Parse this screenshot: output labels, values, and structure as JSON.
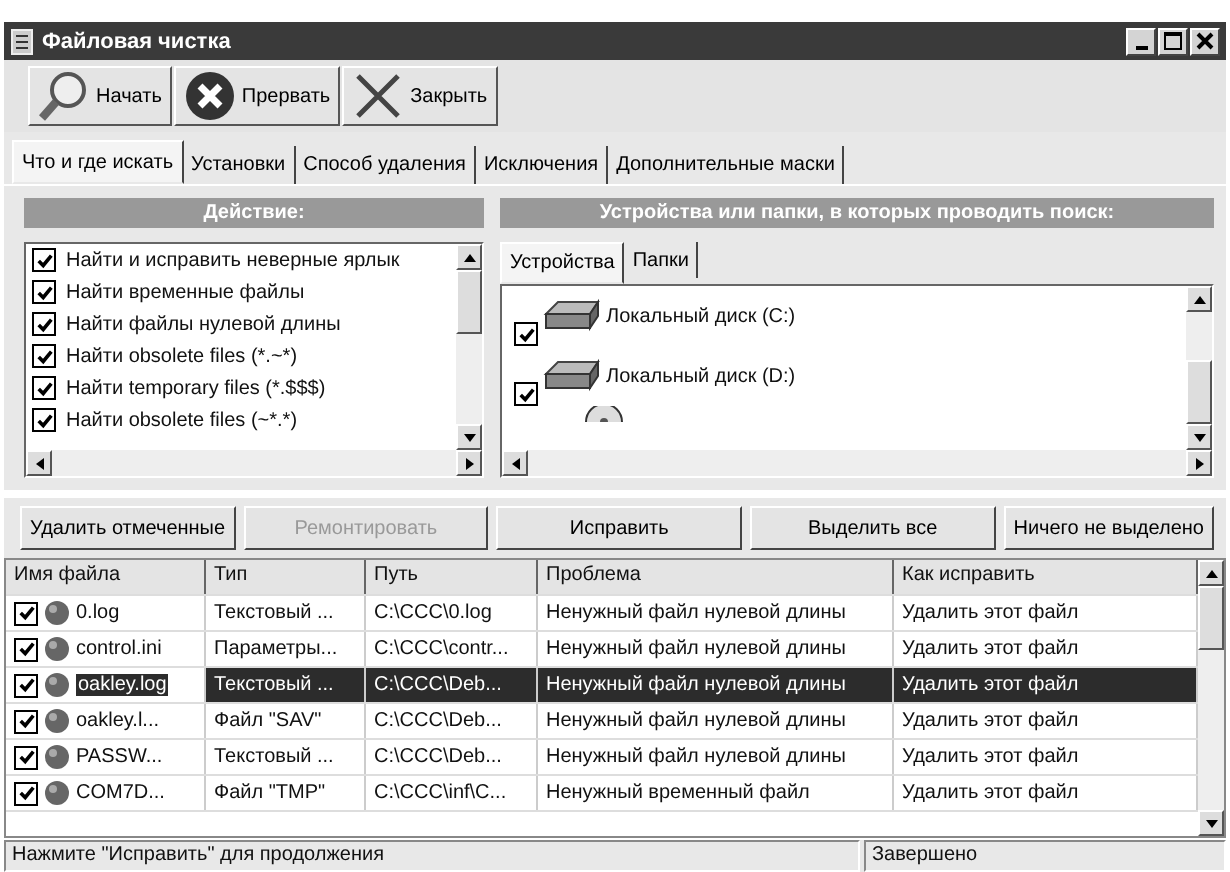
{
  "window": {
    "title": "Файловая чистка"
  },
  "toolbar": [
    {
      "label": "Начать",
      "kind": "search"
    },
    {
      "label": "Прервать",
      "kind": "stop"
    },
    {
      "label": "Закрыть",
      "kind": "close"
    }
  ],
  "tabs": [
    {
      "label": "Что и где искать",
      "selected": true
    },
    {
      "label": "Установки",
      "selected": false
    },
    {
      "label": "Способ удаления",
      "selected": false
    },
    {
      "label": "Исключения",
      "selected": false
    },
    {
      "label": "Дополнительные маски",
      "selected": false
    }
  ],
  "actions": {
    "header": "Действие:",
    "items": [
      {
        "label": "Найти и исправить неверные ярлык",
        "checked": true
      },
      {
        "label": "Найти временные файлы",
        "checked": true
      },
      {
        "label": "Найти файлы нулевой длины",
        "checked": true
      },
      {
        "label": "Найти obsolete files (*.~*)",
        "checked": true
      },
      {
        "label": "Найти temporary files (*.$$$)",
        "checked": true
      },
      {
        "label": "Найти obsolete files (~*.*)",
        "checked": true
      }
    ]
  },
  "locations": {
    "header": "Устройства или папки, в которых проводить поиск:",
    "tabs": [
      {
        "label": "Устройства",
        "selected": true
      },
      {
        "label": "Папки",
        "selected": false
      }
    ],
    "drives": [
      {
        "label": "Локальный диск (C:)",
        "checked": true
      },
      {
        "label": "Локальный диск (D:)",
        "checked": true
      }
    ]
  },
  "buttons": [
    {
      "label": "Удалить отмеченные",
      "disabled": false
    },
    {
      "label": "Ремонтировать",
      "disabled": true
    },
    {
      "label": "Исправить",
      "disabled": false
    },
    {
      "label": "Выделить все",
      "disabled": false
    },
    {
      "label": "Ничего не выделено",
      "disabled": false
    }
  ],
  "table": {
    "columns": [
      "Имя файла",
      "Тип",
      "Путь",
      "Проблема",
      "Как исправить"
    ],
    "rows": [
      {
        "cells": [
          "0.log",
          "Текстовый ...",
          "C:\\CCC\\0.log",
          "Ненужный файл нулевой длины",
          "Удалить этот файл"
        ],
        "checked": true,
        "selected": false
      },
      {
        "cells": [
          "control.ini",
          "Параметры...",
          "C:\\CCC\\contr...",
          "Ненужный файл нулевой длины",
          "Удалить этот файл"
        ],
        "checked": true,
        "selected": false
      },
      {
        "cells": [
          "oakley.log",
          "Текстовый ...",
          "C:\\CCC\\Deb...",
          "Ненужный файл нулевой длины",
          "Удалить этот файл"
        ],
        "checked": true,
        "selected": true
      },
      {
        "cells": [
          "oakley.l...",
          "Файл \"SAV\"",
          "C:\\CCC\\Deb...",
          "Ненужный файл нулевой длины",
          "Удалить этот файл"
        ],
        "checked": true,
        "selected": false
      },
      {
        "cells": [
          "PASSW...",
          "Текстовый ...",
          "C:\\CCC\\Deb...",
          "Ненужный файл нулевой длины",
          "Удалить этот файл"
        ],
        "checked": true,
        "selected": false
      },
      {
        "cells": [
          "COM7D...",
          "Файл \"TMP\"",
          "C:\\CCC\\inf\\C...",
          "Ненужный временный файл",
          "Удалить этот файл"
        ],
        "checked": true,
        "selected": false
      }
    ]
  },
  "status_bar": [
    "Нажмите \"Исправить\" для продолжения",
    "Завершено"
  ]
}
